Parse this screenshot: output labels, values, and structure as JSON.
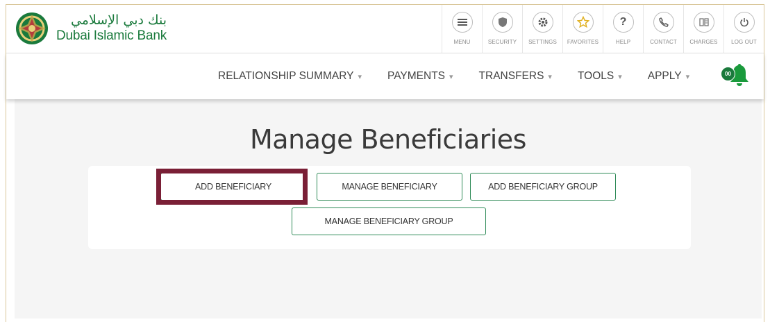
{
  "brand": {
    "name_arabic": "بنك دبي الإسلامي",
    "name_english": "Dubai Islamic Bank",
    "color": "#1a7a3c"
  },
  "toolbar": {
    "items": [
      {
        "label": "MENU",
        "icon": "menu-icon"
      },
      {
        "label": "SECURITY",
        "icon": "shield-icon"
      },
      {
        "label": "SETTINGS",
        "icon": "gear-icon"
      },
      {
        "label": "FAVORITES",
        "icon": "star-icon"
      },
      {
        "label": "HELP",
        "icon": "question-icon"
      },
      {
        "label": "CONTACT",
        "icon": "phone-icon"
      },
      {
        "label": "CHARGES",
        "icon": "charges-icon"
      },
      {
        "label": "LOG OUT",
        "icon": "power-icon"
      }
    ]
  },
  "nav": {
    "items": [
      {
        "label": "RELATIONSHIP SUMMARY"
      },
      {
        "label": "PAYMENTS"
      },
      {
        "label": "TRANSFERS"
      },
      {
        "label": "TOOLS"
      },
      {
        "label": "APPLY"
      }
    ],
    "notifications": {
      "count": "00",
      "icon": "bell-icon"
    }
  },
  "main": {
    "title": "Manage Beneficiaries",
    "buttons": {
      "add_beneficiary": "ADD BENEFICIARY",
      "manage_beneficiary": "MANAGE BENEFICIARY",
      "add_beneficiary_group": "ADD BENEFICIARY GROUP",
      "manage_beneficiary_group": "MANAGE BENEFICIARY GROUP"
    },
    "highlight_color": "#7a1f36",
    "button_border_color": "#2e8a57"
  }
}
